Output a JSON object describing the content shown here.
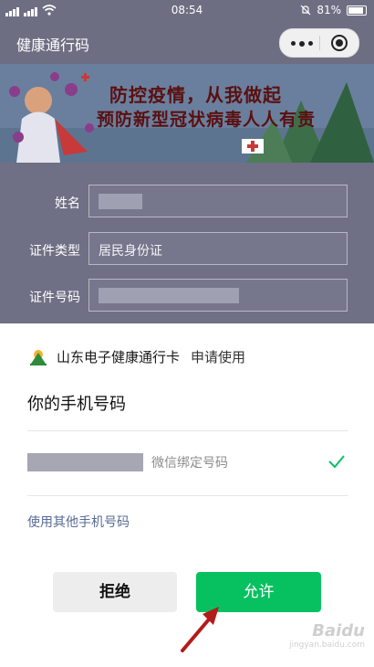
{
  "status_bar": {
    "time": "08:54",
    "battery": "81%"
  },
  "navbar": {
    "title": "健康通行码"
  },
  "banner": {
    "line1": "防控疫情，从我做起",
    "line2": "预防新型冠状病毒人人有责"
  },
  "form": {
    "name_label": "姓名",
    "id_type_label": "证件类型",
    "id_type_value": "居民身份证",
    "id_number_label": "证件号码"
  },
  "sheet": {
    "app_name": "山东电子健康通行卡",
    "request_text": "申请使用",
    "heading": "你的手机号码",
    "phone_desc": "微信绑定号码",
    "other_phone_link": "使用其他手机号码",
    "deny_label": "拒绝",
    "allow_label": "允许"
  },
  "watermark": {
    "brand": "Baidu",
    "site": "jingyan.baidu.com"
  },
  "colors": {
    "accent_green": "#07c160",
    "link_blue": "#576b95"
  }
}
